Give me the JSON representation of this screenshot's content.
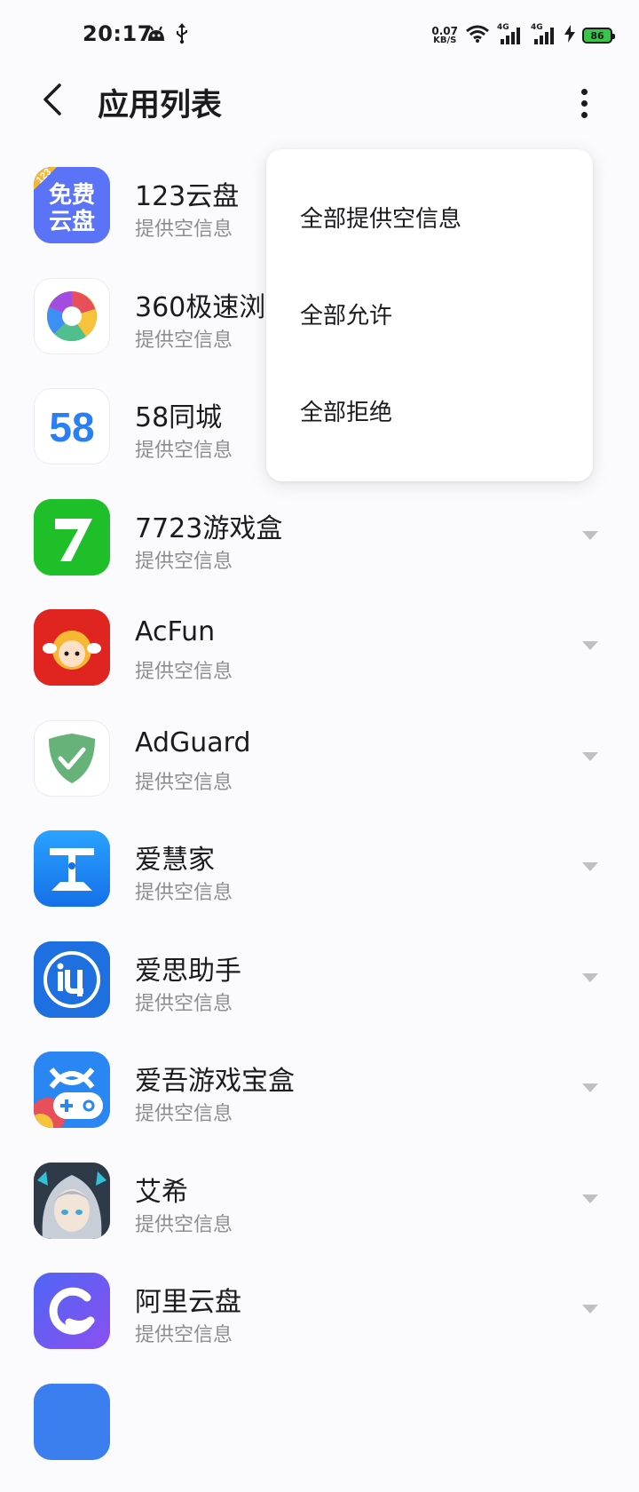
{
  "status_bar": {
    "time": "20:17",
    "net_speed_value": "0.07",
    "net_speed_unit": "KB/S",
    "signal_1_label": "4G",
    "signal_2_label": "4G",
    "battery_level": "86",
    "battery_color": "#39c44a"
  },
  "header": {
    "title": "应用列表"
  },
  "menu": {
    "items": [
      "全部提供空信息",
      "全部允许",
      "全部拒绝"
    ]
  },
  "apps": [
    {
      "name": "123云盘",
      "status": "提供空信息",
      "icon": "cloud-drive-123-icon"
    },
    {
      "name": "360极速浏",
      "status": "提供空信息",
      "icon": "browser-360-icon"
    },
    {
      "name": "58同城",
      "status": "提供空信息",
      "icon": "tongcheng-58-icon"
    },
    {
      "name": "7723游戏盒",
      "status": "提供空信息",
      "icon": "game-box-7723-icon"
    },
    {
      "name": "AcFun",
      "status": "提供空信息",
      "icon": "acfun-icon"
    },
    {
      "name": "AdGuard",
      "status": "提供空信息",
      "icon": "adguard-shield-icon"
    },
    {
      "name": "爱慧家",
      "status": "提供空信息",
      "icon": "aihuijia-icon"
    },
    {
      "name": "爱思助手",
      "status": "提供空信息",
      "icon": "aisi-icon"
    },
    {
      "name": "爱吾游戏宝盒",
      "status": "提供空信息",
      "icon": "aiwu-game-icon"
    },
    {
      "name": "艾希",
      "status": "提供空信息",
      "icon": "icey-icon"
    },
    {
      "name": "阿里云盘",
      "status": "提供空信息",
      "icon": "aliyun-drive-icon"
    }
  ],
  "icon_texts": {
    "cloud123_badge": "123",
    "cloud123_line1": "免费",
    "cloud123_line2": "云盘",
    "tongcheng_58": "58"
  }
}
